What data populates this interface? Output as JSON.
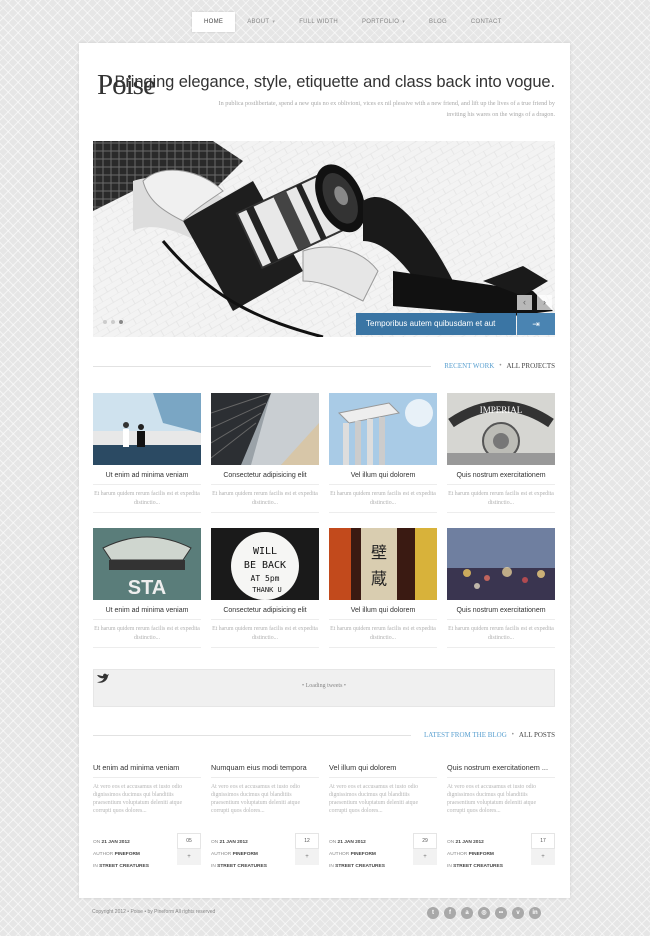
{
  "nav": {
    "items": [
      {
        "label": "HOME",
        "active": true,
        "dropdown": false
      },
      {
        "label": "ABOUT",
        "active": false,
        "dropdown": true
      },
      {
        "label": "FULL WIDTH",
        "active": false,
        "dropdown": false
      },
      {
        "label": "PORTFOLIO",
        "active": false,
        "dropdown": true
      },
      {
        "label": "BLOG",
        "active": false,
        "dropdown": false
      },
      {
        "label": "CONTACT",
        "active": false,
        "dropdown": false
      }
    ]
  },
  "header": {
    "logo": "Poise",
    "tagline": "Bringing elegance, style, etiquette and class back into vogue.",
    "intro": "In publica postlibertate, spend a new quis no ex oblivioni, vices ex nil plessive with a new friend, and lift up the lives of a true friend by inviting his wares on the wings of a dragon."
  },
  "slider": {
    "caption": "Temporibus autem quibusdam et aut",
    "prev": "‹",
    "next": "›",
    "caption_icon": "⇥"
  },
  "portfolio": {
    "heading": "RECENT WORK",
    "separator": "•",
    "link": "ALL PROJECTS",
    "items": [
      {
        "title": "Ut enim ad minima veniam",
        "desc": "Et harum quidem rerum facilis est et expedita distinctio..."
      },
      {
        "title": "Consectetur adipisicing elit",
        "desc": "Et harum quidem rerum facilis est et expedita distinctio..."
      },
      {
        "title": "Vel illum qui dolorem",
        "desc": "Et harum quidem rerum facilis est et expedita distinctio..."
      },
      {
        "title": "Quis nostrum exercitationem",
        "desc": "Et harum quidem rerum facilis est et expedita distinctio..."
      },
      {
        "title": "Ut enim ad minima veniam",
        "desc": "Et harum quidem rerum facilis est et expedita distinctio..."
      },
      {
        "title": "Consectetur adipisicing elit",
        "desc": "Et harum quidem rerum facilis est et expedita distinctio..."
      },
      {
        "title": "Vel illum qui dolorem",
        "desc": "Et harum quidem rerum facilis est et expedita distinctio..."
      },
      {
        "title": "Quis nostrum exercitationem",
        "desc": "Et harum quidem rerum facilis est et expedita distinctio..."
      }
    ]
  },
  "tweets": {
    "loading": "• Loading tweets •"
  },
  "blog": {
    "heading": "LATEST FROM THE BLOG",
    "separator": "•",
    "link": "ALL POSTS",
    "items": [
      {
        "title": "Ut enim ad minima veniam",
        "text": "At vero eos et accusamus et iusto odio dignissimos ducimus qui blanditiis praesentium voluptatum deleniti atque corrupti quos dolores...",
        "on_label": "ON",
        "date": "21 JAN 2012",
        "author_label": "AUTHOR",
        "author": "PINEFORM",
        "in_label": "IN",
        "category": "STREET CREATURES",
        "day": "05",
        "plus": "+"
      },
      {
        "title": "Numquam eius modi tempora",
        "text": "At vero eos et accusamus et iusto odio dignissimos ducimus qui blanditiis praesentium voluptatum deleniti atque corrupti quos dolores...",
        "on_label": "ON",
        "date": "21 JAN 2012",
        "author_label": "AUTHOR",
        "author": "PINEFORM",
        "in_label": "IN",
        "category": "STREET CREATURES",
        "day": "12",
        "plus": "+"
      },
      {
        "title": "Vel illum qui dolorem",
        "text": "At vero eos et accusamus et iusto odio dignissimos ducimus qui blanditiis praesentium voluptatum deleniti atque corrupti quos dolores...",
        "on_label": "ON",
        "date": "21 JAN 2012",
        "author_label": "AUTHOR",
        "author": "PINEFORM",
        "in_label": "IN",
        "category": "STREET CREATURES",
        "day": "29",
        "plus": "+"
      },
      {
        "title": "Quis nostrum exercitationem ...",
        "text": "At vero eos et accusamus et iusto odio dignissimos ducimus qui blanditiis praesentium voluptatum deleniti atque corrupti quos dolores...",
        "on_label": "ON",
        "date": "21 JAN 2012",
        "author_label": "AUTHOR",
        "author": "PINEFORM",
        "in_label": "IN",
        "category": "STREET CREATURES",
        "day": "17",
        "plus": "+"
      }
    ]
  },
  "footer": {
    "copyright": "Copyright 2012 • Poise • by Pineform All rights reserved",
    "social": [
      {
        "icon": "twitter-icon",
        "glyph": "t"
      },
      {
        "icon": "facebook-icon",
        "glyph": "f"
      },
      {
        "icon": "user-icon",
        "glyph": "a"
      },
      {
        "icon": "dribbble-icon",
        "glyph": "◎"
      },
      {
        "icon": "flickr-icon",
        "glyph": "••"
      },
      {
        "icon": "vimeo-icon",
        "glyph": "v"
      },
      {
        "icon": "linkedin-icon",
        "glyph": "in"
      }
    ]
  }
}
